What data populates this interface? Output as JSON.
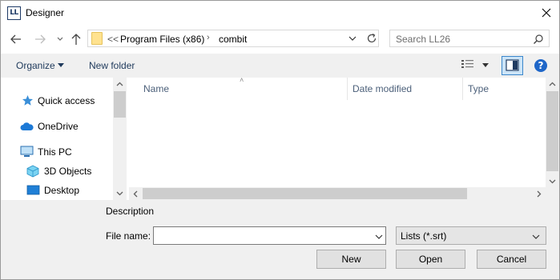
{
  "window": {
    "title": "Designer",
    "app_icon_text": "LL"
  },
  "address": {
    "root_chevron": "<<",
    "crumbs": [
      "Program Files (x86)",
      "combit"
    ]
  },
  "search": {
    "placeholder": "Search LL26"
  },
  "toolbar": {
    "organize_label": "Organize",
    "new_folder_label": "New folder"
  },
  "nav_pane": {
    "items": [
      {
        "label": "Quick access",
        "icon": "star-icon"
      },
      {
        "label": "OneDrive",
        "icon": "cloud-icon"
      },
      {
        "label": "This PC",
        "icon": "computer-icon"
      },
      {
        "label": "3D Objects",
        "icon": "cube-icon"
      },
      {
        "label": "Desktop",
        "icon": "desktop-icon"
      }
    ]
  },
  "file_list": {
    "columns": [
      "Name",
      "Date modified",
      "Type"
    ],
    "rows": []
  },
  "bottom": {
    "description_label": "Description",
    "file_name_label": "File name:",
    "file_name_value": "",
    "filter_value": "Lists (*.srt)",
    "new_button": "New",
    "open_button": "Open",
    "cancel_button": "Cancel"
  },
  "colors": {
    "accent": "#1e66c8",
    "toolbar_text": "#1e395b",
    "folder": "#ffe28f"
  }
}
